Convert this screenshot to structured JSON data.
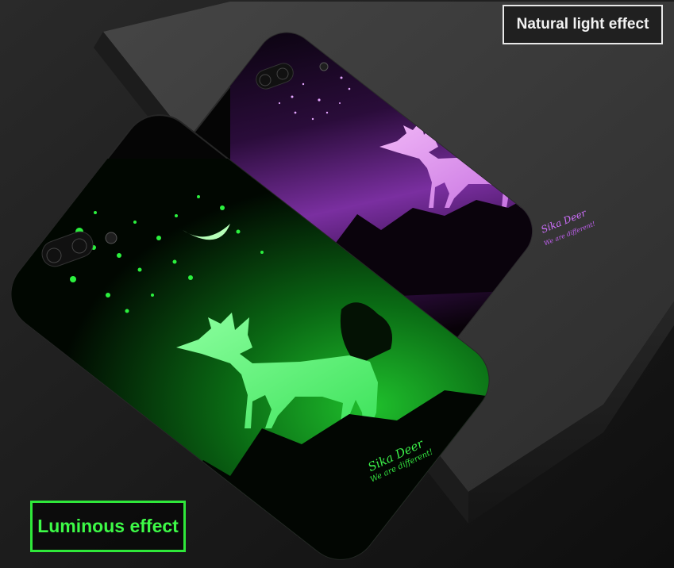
{
  "badges": {
    "natural": "Natural light effect",
    "luminous": "Luminous effect"
  },
  "phone_purple": {
    "title": "Sika Deer",
    "tagline": "We are different!"
  },
  "phone_green": {
    "title": "Sika Deer",
    "tagline": "We are different!"
  },
  "colors": {
    "purple_glow": "#c46be8",
    "green_glow": "#3cf04a",
    "background": "#1a1a1a"
  }
}
